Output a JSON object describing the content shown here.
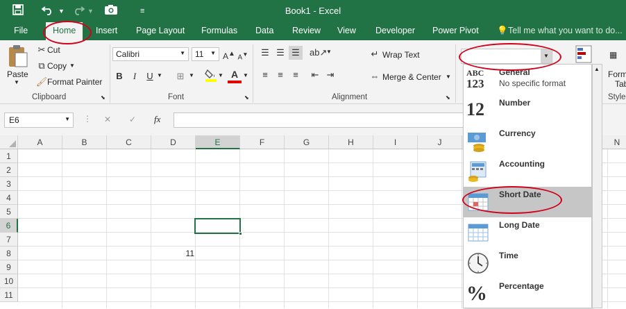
{
  "window": {
    "title": "Book1 - Excel"
  },
  "qat": {
    "save_icon": "save-icon",
    "undo_icon": "undo-icon",
    "redo_icon": "redo-icon",
    "camera_icon": "camera-icon",
    "customize_icon": "customize-icon"
  },
  "tabs": [
    "File",
    "Home",
    "Insert",
    "Page Layout",
    "Formulas",
    "Data",
    "Review",
    "View",
    "Developer",
    "Power Pivot"
  ],
  "tell_me": "Tell me what you want to do...",
  "clipboard": {
    "paste": "Paste",
    "cut": "Cut",
    "copy": "Copy",
    "format_painter": "Format Painter",
    "group": "Clipboard"
  },
  "font": {
    "name": "Calibri",
    "size": "11",
    "bold": "B",
    "italic": "I",
    "underline": "U",
    "font_color": "A",
    "group": "Font"
  },
  "alignment": {
    "wrap_text": "Wrap Text",
    "merge_center": "Merge & Center",
    "group": "Alignment"
  },
  "number_format": {
    "value": ""
  },
  "right_edge": {
    "format": "Form",
    "table": "Tab",
    "styles": "Styles"
  },
  "formula_bar": {
    "name_box": "E6",
    "fx": "fx",
    "cancel": "✕",
    "enter": "✓",
    "content": ""
  },
  "sheet": {
    "columns": [
      "A",
      "B",
      "C",
      "D",
      "E",
      "F",
      "G",
      "H",
      "I",
      "J",
      "N"
    ],
    "rows": [
      "1",
      "2",
      "3",
      "4",
      "5",
      "6",
      "7",
      "8",
      "9",
      "10",
      "11"
    ],
    "selected_cell": "E6",
    "cell_D8": "11"
  },
  "number_menu": {
    "items": [
      {
        "label": "General",
        "sub": "No specific format",
        "icon": "abc-123-icon"
      },
      {
        "label": "Number",
        "sub": "",
        "icon": "number-12-icon"
      },
      {
        "label": "Currency",
        "sub": "",
        "icon": "currency-icon"
      },
      {
        "label": "Accounting",
        "sub": "",
        "icon": "accounting-icon"
      },
      {
        "label": "Short Date",
        "sub": "",
        "icon": "short-date-icon"
      },
      {
        "label": "Long Date",
        "sub": "",
        "icon": "long-date-icon"
      },
      {
        "label": "Time",
        "sub": "",
        "icon": "clock-icon"
      },
      {
        "label": "Percentage",
        "sub": "",
        "icon": "percent-icon"
      }
    ],
    "highlighted": "Short Date"
  },
  "colors": {
    "excel_green": "#217346",
    "annotation_red": "#d0021b",
    "ribbon_bg": "#f3f3f3"
  }
}
